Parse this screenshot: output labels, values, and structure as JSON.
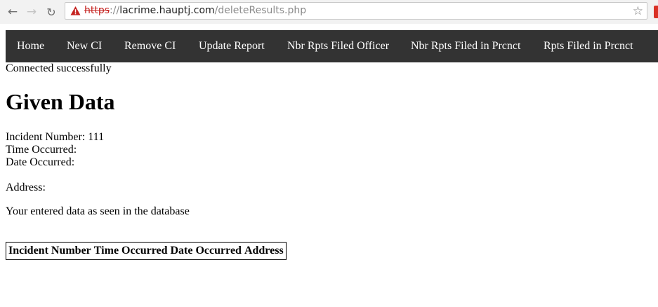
{
  "browser": {
    "url_scheme": "https",
    "url_separator": "://",
    "url_host": "lacrime.hauptj.com",
    "url_path": "/deleteResults.php",
    "back_icon": "arrow-left-icon",
    "forward_icon": "arrow-right-icon",
    "reload_icon": "reload-icon",
    "security_icon": "warning-triangle-icon",
    "bookmark_icon": "star-icon",
    "warning_color": "#c5221f"
  },
  "navbar": {
    "background": "#333333",
    "items": [
      {
        "label": "Home"
      },
      {
        "label": "New CI"
      },
      {
        "label": "Remove CI"
      },
      {
        "label": "Update Report"
      },
      {
        "label": "Nbr Rpts Filed Officer"
      },
      {
        "label": "Nbr Rpts Filed in Prcnct"
      },
      {
        "label": "Rpts Filed in Prcnct"
      }
    ]
  },
  "status": "Connected successfully",
  "heading": "Given Data",
  "fields": {
    "incident_number": "Incident Number: 111",
    "time_occurred": "Time Occurred:",
    "date_occurred": "Date Occurred:",
    "address": "Address:"
  },
  "db_note": "Your entered data as seen in the database",
  "table": {
    "headers": [
      "Incident Number",
      "Time Occurred",
      "Date Occurred",
      "Address"
    ]
  }
}
